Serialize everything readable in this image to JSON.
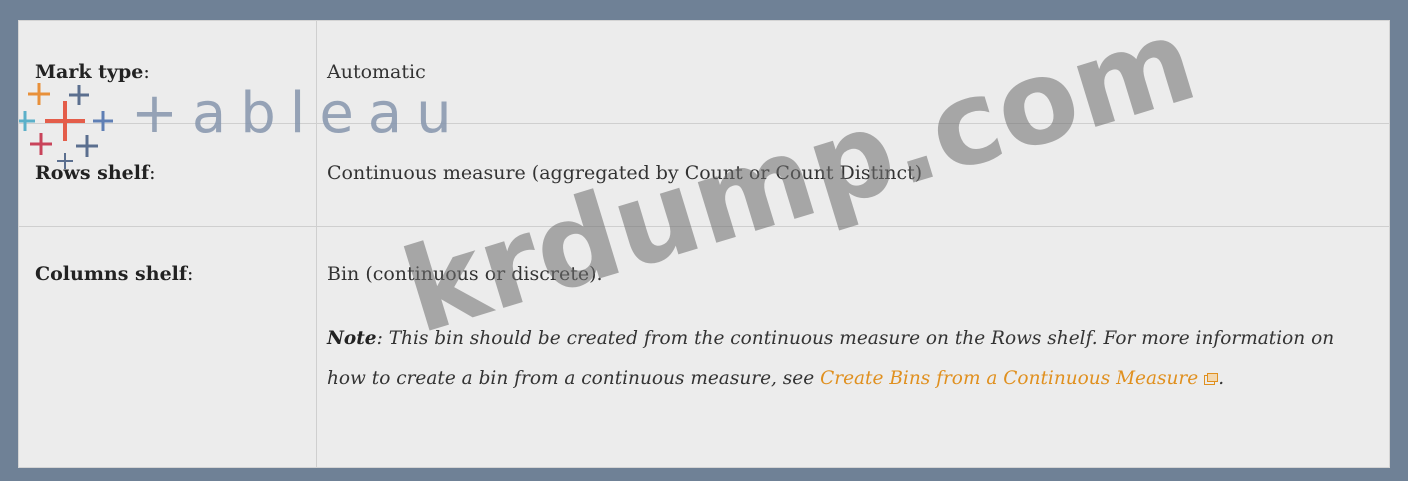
{
  "rows": [
    {
      "label": "Mark type",
      "value": "Automatic"
    },
    {
      "label": "Rows shelf",
      "value": "Continuous measure (aggregated by Count or Count Distinct)"
    },
    {
      "label": "Columns shelf",
      "value": "Bin (continuous or discrete)."
    }
  ],
  "note": {
    "prefix": "Note",
    "body": ": This bin should be created from the continuous measure on the Rows shelf. For more information on how to create a bin from a continuous measure, see ",
    "link_text": "Create Bins from a Continuous Measure",
    "suffix": "."
  },
  "logo": {
    "text": "+ableau"
  },
  "watermark": {
    "text": "krdump.com"
  },
  "colors": {
    "link": "#e0901f",
    "frame": "#6f8196",
    "panel": "#ececec"
  }
}
